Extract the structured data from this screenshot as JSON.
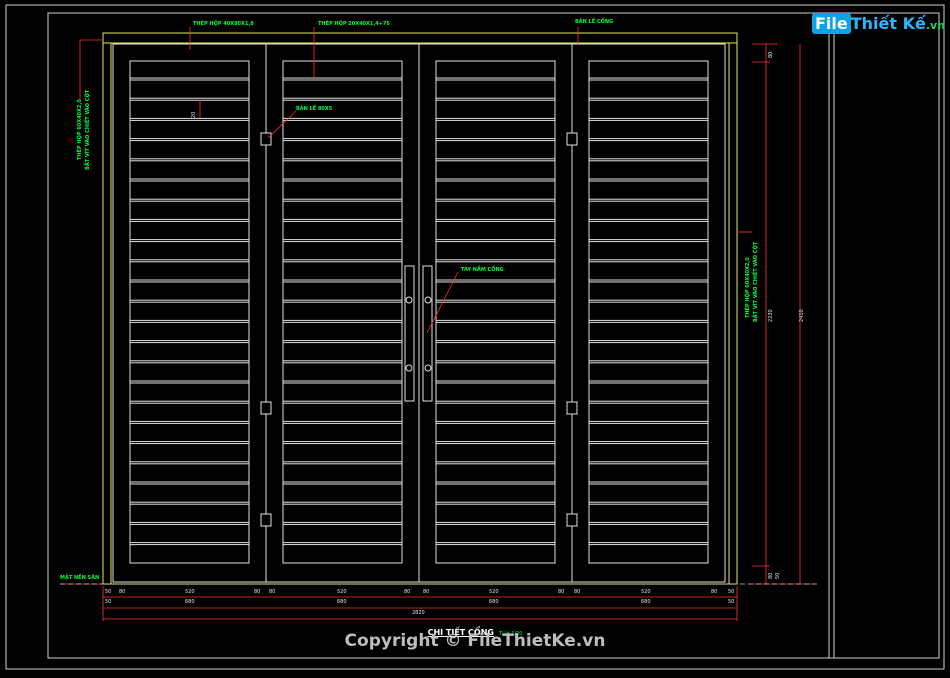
{
  "logo": {
    "part1": "File",
    "part2": "Thiết Kế",
    "part3": ".vn"
  },
  "watermark": "Copyright © FileThietKe.vn",
  "title": {
    "main": "CHI TIẾT CỔNG",
    "scale": "Tỉ lệ 1/20"
  },
  "labels": {
    "top_left": "THÉP HỘP 40X80X1,8",
    "top_mid": "THÉP HỘP 20X40X1,4+75",
    "top_right": "BẢN LỀ CỔNG",
    "hinge": "BẢN LỀ 80X5",
    "handle": "TAY NẮM CỔNG",
    "ground": "MẶT NỀN SÂN",
    "dim_20": "20",
    "left_vertical_1": "THÉP HỘP 60X40X2,0",
    "left_vertical_2": "BẮT VÍT VÀO CHIẾT VÀO CỘT",
    "right_vertical_1": "THÉP HỘP 60X40X2,0",
    "right_vertical_2": "BẮT VÍT VÀO CHIẾT VÀO CỘT"
  },
  "dims_bottom_row1": [
    "50",
    "80",
    "520",
    "80",
    "80",
    "520",
    "80",
    "80",
    "520",
    "80",
    "80",
    "520",
    "80",
    "50"
  ],
  "dims_bottom_row2": [
    "50",
    "680",
    "680",
    "680",
    "680",
    "50"
  ],
  "dim_total": "2820",
  "dims_right": {
    "top": "80",
    "inner": "2230",
    "outer": "2410",
    "bottom1": "80",
    "bottom2": "50"
  }
}
